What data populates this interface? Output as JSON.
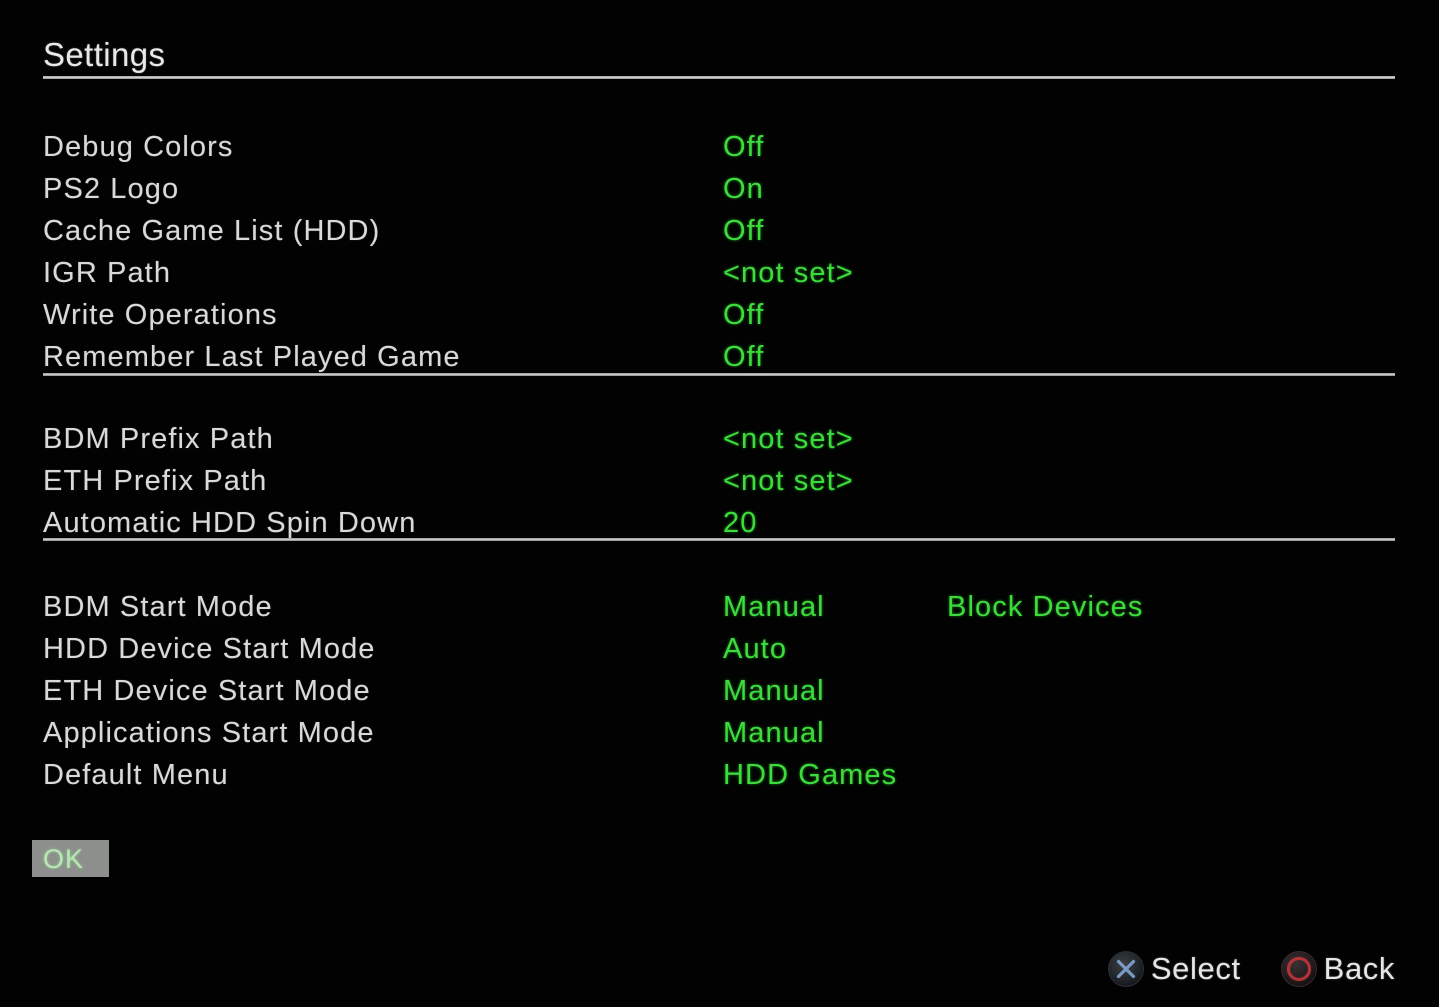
{
  "screen": {
    "title": "Settings",
    "background_color": "#010201",
    "label_color": "#d9d9d9",
    "value_color": "#3ddc3d"
  },
  "groups": [
    {
      "id": "group-1",
      "rows": [
        {
          "label": "Debug Colors",
          "value": "Off"
        },
        {
          "label": "PS2 Logo",
          "value": "On"
        },
        {
          "label": "Cache Game List (HDD)",
          "value": "Off"
        },
        {
          "label": "IGR Path",
          "value": "<not set>"
        },
        {
          "label": "Write Operations",
          "value": "Off"
        },
        {
          "label": "Remember Last Played Game",
          "value": "Off"
        }
      ]
    },
    {
      "id": "group-2",
      "rows": [
        {
          "label": "BDM Prefix Path",
          "value": "<not set>"
        },
        {
          "label": "ETH Prefix Path",
          "value": "<not set>"
        },
        {
          "label": "Automatic HDD Spin Down",
          "value": "20"
        }
      ]
    },
    {
      "id": "group-3",
      "rows": [
        {
          "label": "BDM Start Mode",
          "value": "Manual",
          "value2": "Block Devices"
        },
        {
          "label": "HDD Device Start Mode",
          "value": "Auto"
        },
        {
          "label": "ETH Device Start Mode",
          "value": "Manual"
        },
        {
          "label": "Applications Start Mode",
          "value": "Manual"
        },
        {
          "label": "Default Menu",
          "value": "HDD Games"
        }
      ]
    }
  ],
  "ok_button": {
    "label": "OK",
    "background_color": "#8d8f8d",
    "text_color": "#b8e8b2"
  },
  "hints": [
    {
      "icon": "cross-button-icon",
      "label": "Select",
      "accent_color": "#6f8fbf"
    },
    {
      "icon": "circle-button-icon",
      "label": "Back",
      "accent_color": "#b03030"
    }
  ]
}
